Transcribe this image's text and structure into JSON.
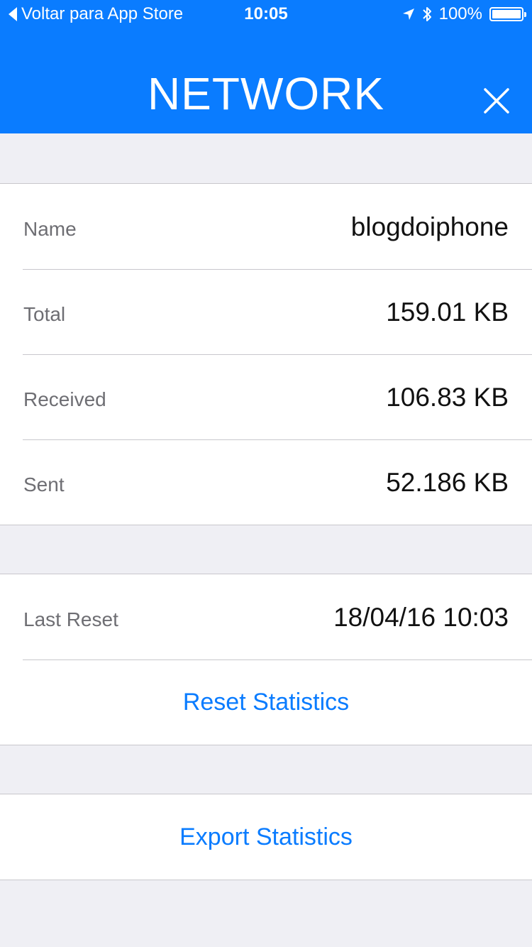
{
  "status_bar": {
    "back_label": "Voltar para App Store",
    "time": "10:05",
    "battery_text": "100%",
    "battery_level": 1.0,
    "icons": [
      "location-arrow-icon",
      "bluetooth-icon",
      "battery-icon"
    ]
  },
  "header": {
    "title": "NETWORK",
    "close_icon": "close-icon"
  },
  "stats": {
    "rows": [
      {
        "label": "Name",
        "value": "blogdoiphone"
      },
      {
        "label": "Total",
        "value": "159.01 KB"
      },
      {
        "label": "Received",
        "value": "106.83 KB"
      },
      {
        "label": "Sent",
        "value": "52.186 KB"
      }
    ]
  },
  "reset": {
    "last_reset_label": "Last Reset",
    "last_reset_value": "18/04/16 10:03",
    "reset_button": "Reset Statistics"
  },
  "export": {
    "export_button": "Export Statistics"
  },
  "colors": {
    "accent": "#0a7cff",
    "background": "#efeff4",
    "separator": "#c8c7cc",
    "label": "#6e6e73",
    "value": "#111111"
  }
}
